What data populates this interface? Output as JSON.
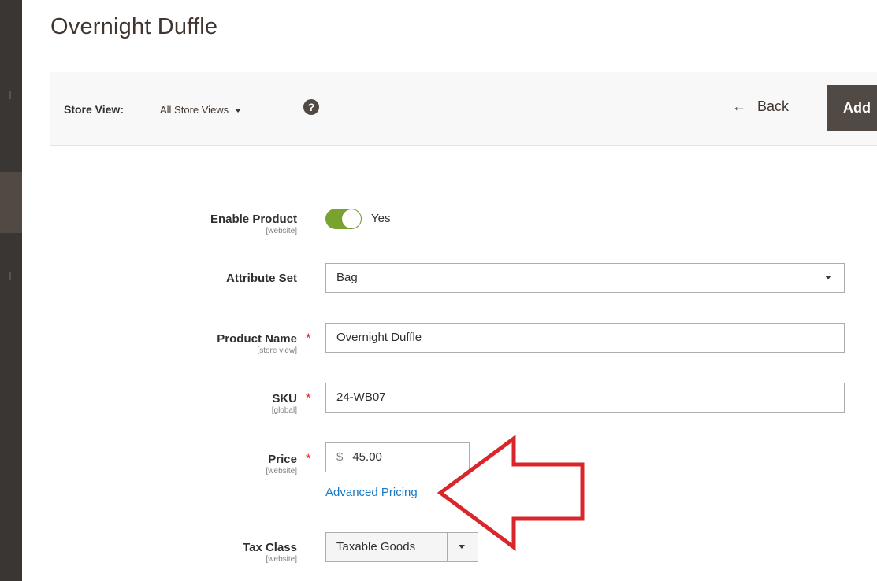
{
  "page": {
    "title": "Overnight Duffle"
  },
  "actions_bar": {
    "store_view_label": "Store View:",
    "store_view_value": "All Store Views",
    "help_glyph": "?",
    "back_label": "Back",
    "back_icon": "arrow-left-icon",
    "add_label": "Add"
  },
  "form": {
    "enable_product": {
      "label": "Enable Product",
      "scope": "[website]",
      "state_text": "Yes",
      "enabled": true,
      "toggle_color": "#79a22e"
    },
    "attribute_set": {
      "label": "Attribute Set",
      "value": "Bag"
    },
    "product_name": {
      "label": "Product Name",
      "scope": "[store view]",
      "required_mark": "*",
      "value": "Overnight Duffle"
    },
    "sku": {
      "label": "SKU",
      "scope": "[global]",
      "required_mark": "*",
      "value": "24-WB07"
    },
    "price": {
      "label": "Price",
      "scope": "[website]",
      "required_mark": "*",
      "currency": "$",
      "value": "45.00",
      "advanced_link": "Advanced Pricing"
    },
    "tax_class": {
      "label": "Tax Class",
      "scope": "[website]",
      "value": "Taxable Goods"
    }
  },
  "colors": {
    "sidebar": "#3a3633",
    "primary_button": "#514943",
    "link": "#1979c3",
    "required": "#e22626",
    "annotation": "#d9262b"
  }
}
